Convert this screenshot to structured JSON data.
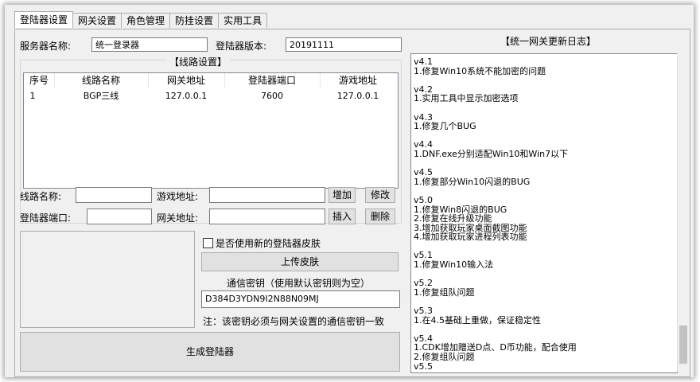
{
  "tabs": [
    "登陆器设置",
    "网关设置",
    "角色管理",
    "防挂设置",
    "实用工具"
  ],
  "server_name_label": "服务器名称:",
  "server_name_value": "统一登录器",
  "version_label": "登陆器版本:",
  "version_value": "20191111",
  "lines_group_title": "【线路设置】",
  "table": {
    "headers": [
      "序号",
      "线路名称",
      "网关地址",
      "登陆器端口",
      "游戏地址"
    ],
    "rows": [
      [
        "1",
        "BGP三线",
        "127.0.0.1",
        "7600",
        "127.0.0.1"
      ]
    ]
  },
  "form": {
    "line_name_label": "线路名称:",
    "game_addr_label": "游戏地址:",
    "port_label": "登陆器端口:",
    "gateway_addr_label": "网关地址:",
    "add_button": "增加",
    "modify_button": "修改",
    "insert_button": "插入",
    "delete_button": "删除"
  },
  "skin_checkbox_label": "是否使用新的登陆器皮肤",
  "upload_skin_button": "上传皮肤",
  "key_title": "通信密钥（使用默认密钥则为空）",
  "key_value": "D384D3YDN9I2N88N09MJ",
  "key_note": "注：该密钥必须与网关设置的通信密钥一致",
  "generate_button": "生成登陆器",
  "log": {
    "title": "【统一网关更新日志】",
    "lines": [
      "v4.1",
      "1.修复Win10系统不能加密的问题",
      "",
      "v4.2",
      "1.实用工具中显示加密选项",
      "",
      "v4.3",
      "1.修复几个BUG",
      "",
      "v4.4",
      "1.DNF.exe分别适配Win10和Win7以下",
      "",
      "v4.5",
      "1.修复部分Win10闪退的BUG",
      "",
      "v5.0",
      "1.修复Win8闪退的BUG",
      "2.修复在线升级功能",
      "3.增加获取玩家桌面截图功能",
      "4.增加获取玩家进程列表功能",
      "",
      "v5.1",
      "1.修复Win10输入法",
      "",
      "v5.2",
      "1.修复组队问题",
      "",
      "v5.3",
      "1.在4.5基础上重做，保证稳定性",
      "",
      "v5.4",
      "1.CDK增加赠送D点、D币功能，配合使用",
      "2.修复组队问题",
      "v5.5"
    ]
  }
}
